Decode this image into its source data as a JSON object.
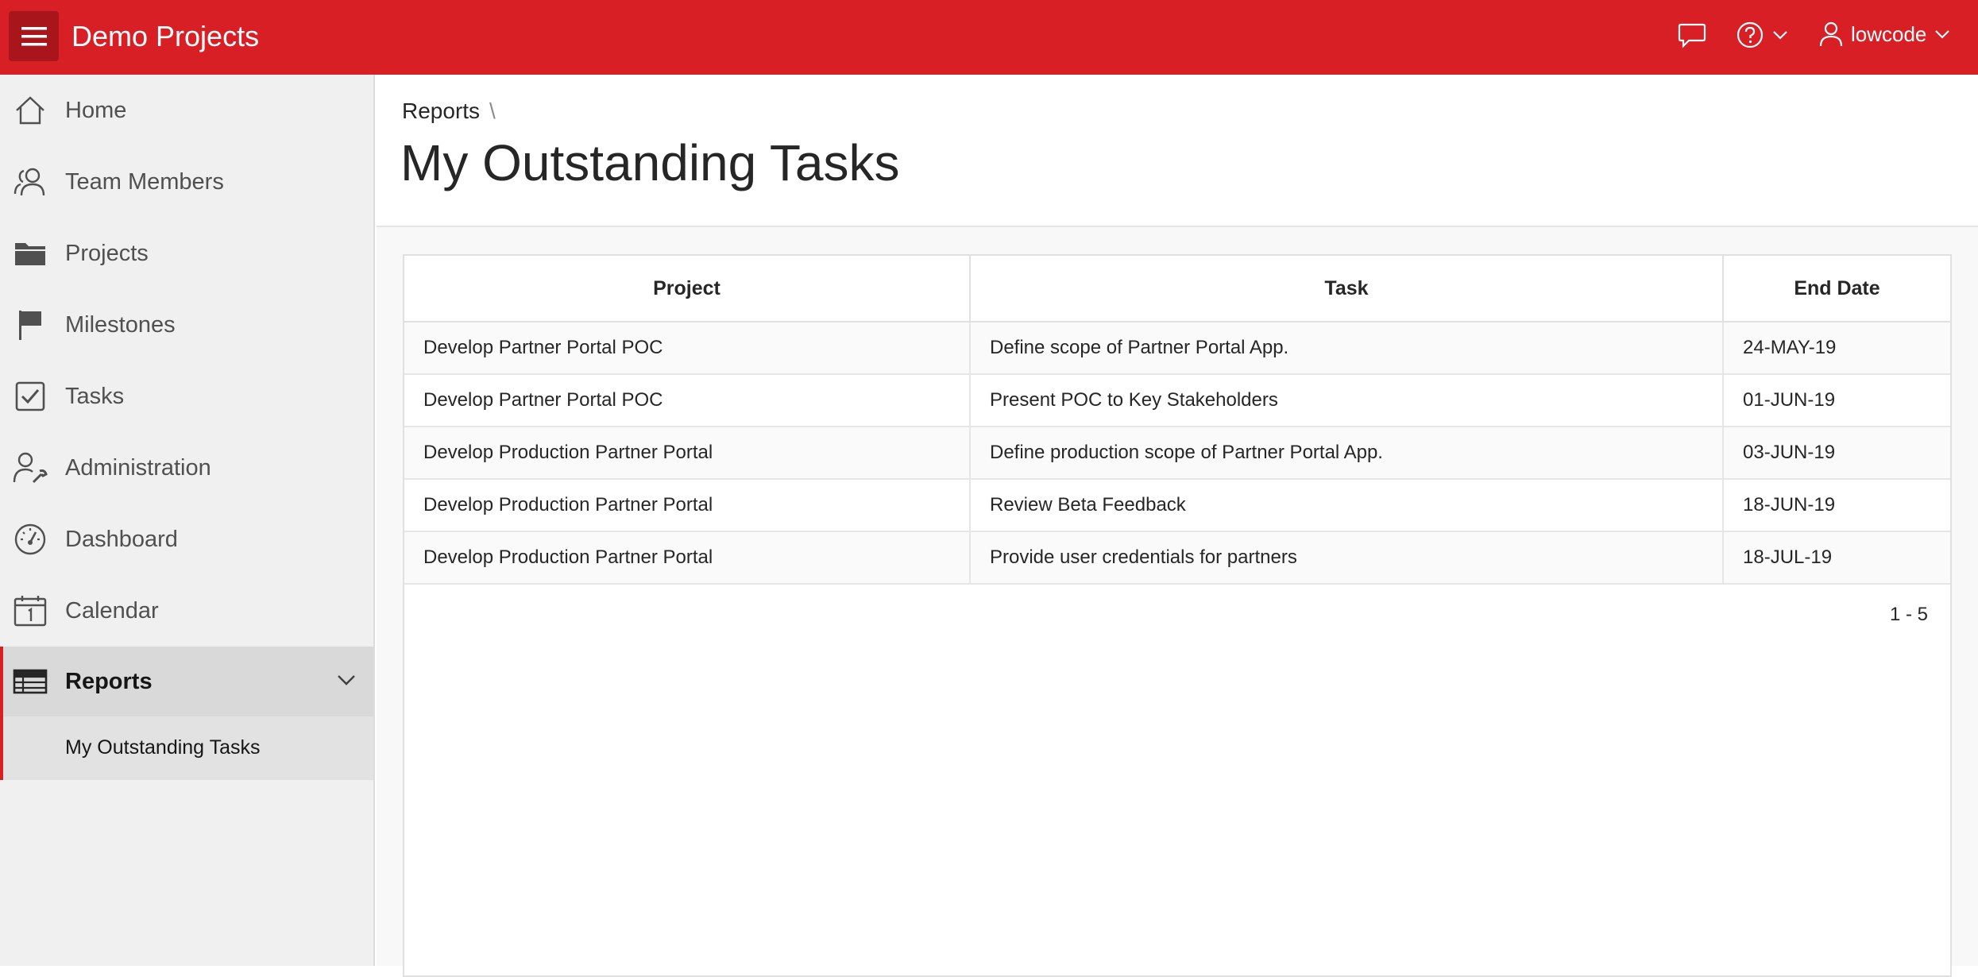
{
  "header": {
    "app_title": "Demo Projects",
    "user_name": "lowcode",
    "accent_color": "#d81f26"
  },
  "sidebar": {
    "items": [
      {
        "label": "Home",
        "icon": "home-icon"
      },
      {
        "label": "Team Members",
        "icon": "people-icon"
      },
      {
        "label": "Projects",
        "icon": "folder-icon"
      },
      {
        "label": "Milestones",
        "icon": "flag-icon"
      },
      {
        "label": "Tasks",
        "icon": "checkbox-icon"
      },
      {
        "label": "Administration",
        "icon": "user-wrench-icon"
      },
      {
        "label": "Dashboard",
        "icon": "gauge-icon"
      },
      {
        "label": "Calendar",
        "icon": "calendar-icon"
      },
      {
        "label": "Reports",
        "icon": "table-icon",
        "expanded": true
      }
    ],
    "subitem": {
      "label": "My Outstanding Tasks"
    }
  },
  "breadcrumb": {
    "parent": "Reports",
    "separator": "\\"
  },
  "page": {
    "title": "My Outstanding Tasks"
  },
  "report": {
    "columns": [
      "Project",
      "Task",
      "End Date"
    ],
    "rows": [
      [
        "Develop Partner Portal POC",
        "Define scope of Partner Portal App.",
        "24-MAY-19"
      ],
      [
        "Develop Partner Portal POC",
        "Present POC to Key Stakeholders",
        "01-JUN-19"
      ],
      [
        "Develop Production Partner Portal",
        "Define production scope of Partner Portal App.",
        "03-JUN-19"
      ],
      [
        "Develop Production Partner Portal",
        "Review Beta Feedback",
        "18-JUN-19"
      ],
      [
        "Develop Production Partner Portal",
        "Provide user credentials for partners",
        "18-JUL-19"
      ]
    ],
    "pagination": "1 - 5"
  }
}
